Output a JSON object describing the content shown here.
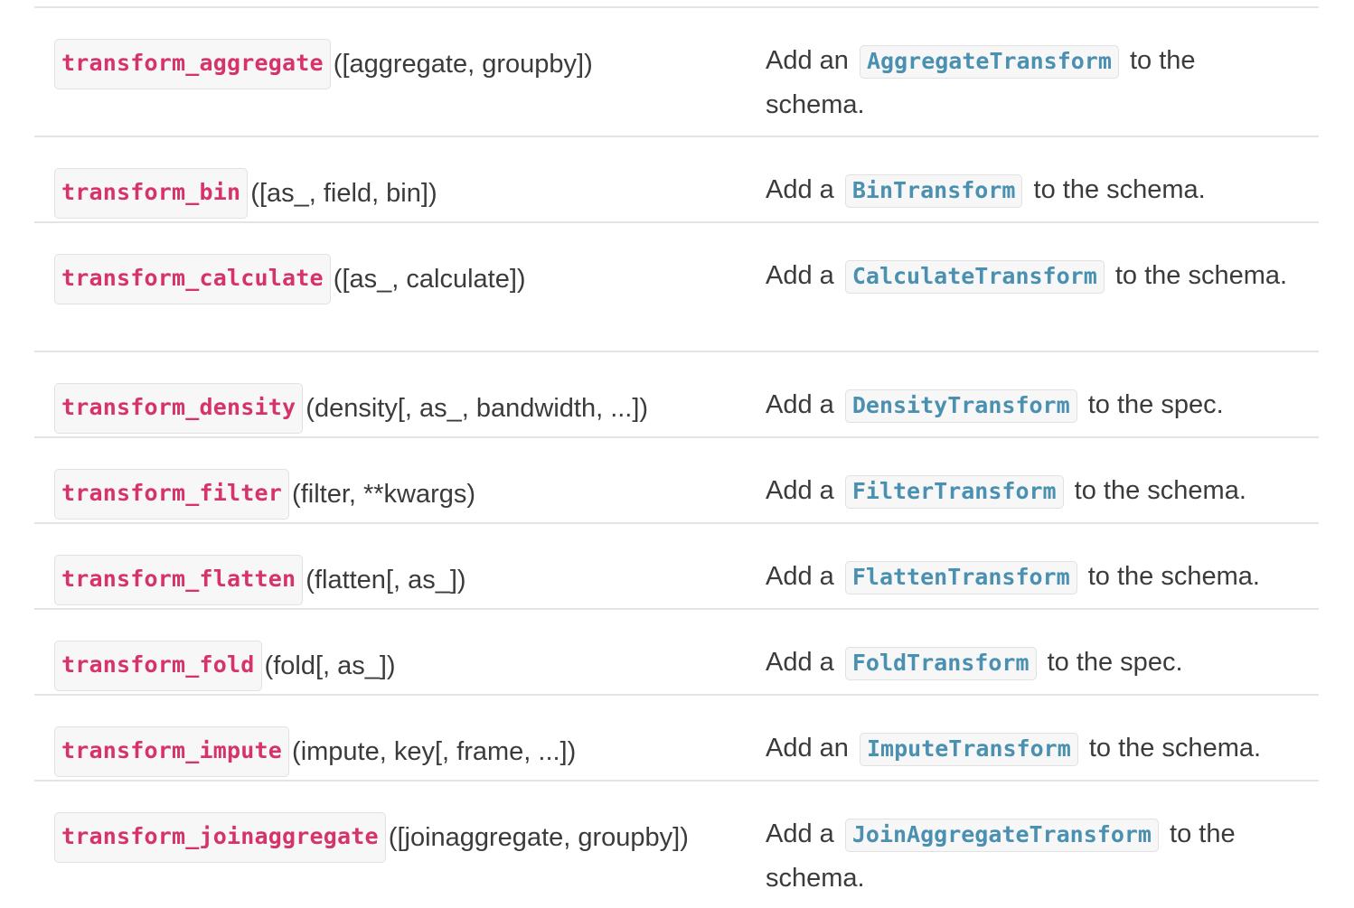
{
  "rows": [
    {
      "name": "transform_aggregate",
      "args": "([aggregate, groupby])",
      "prefix": "Add an",
      "cls": "AggregateTransform",
      "suffix": "to the schema."
    },
    {
      "name": "transform_bin",
      "args": "([as_, field, bin])",
      "prefix": "Add a",
      "cls": "BinTransform",
      "suffix": "to the schema."
    },
    {
      "name": "transform_calculate",
      "args": "([as_, calculate])",
      "prefix": "Add a",
      "cls": "CalculateTransform",
      "suffix": "to the schema."
    },
    {
      "name": "transform_density",
      "args": "(density[, as_, bandwidth, ...])",
      "prefix": "Add a",
      "cls": "DensityTransform",
      "suffix": "to the spec."
    },
    {
      "name": "transform_filter",
      "args": "(filter, **kwargs)",
      "prefix": "Add a",
      "cls": "FilterTransform",
      "suffix": "to the schema."
    },
    {
      "name": "transform_flatten",
      "args": "(flatten[, as_])",
      "prefix": "Add a",
      "cls": "FlattenTransform",
      "suffix": "to the schema."
    },
    {
      "name": "transform_fold",
      "args": "(fold[, as_])",
      "prefix": "Add a",
      "cls": "FoldTransform",
      "suffix": "to the spec."
    },
    {
      "name": "transform_impute",
      "args": "(impute, key[, frame, ...])",
      "prefix": "Add an",
      "cls": "ImputeTransform",
      "suffix": "to the schema."
    },
    {
      "name": "transform_joinaggregate",
      "args": "([joinaggregate, groupby])",
      "prefix": "Add a",
      "cls": "JoinAggregateTransform",
      "suffix": "to the schema."
    }
  ],
  "colors": {
    "function_name": "#d6336c",
    "class_name": "#4a90b0",
    "text": "#3b3b3b",
    "divider": "#e4e4e4"
  }
}
